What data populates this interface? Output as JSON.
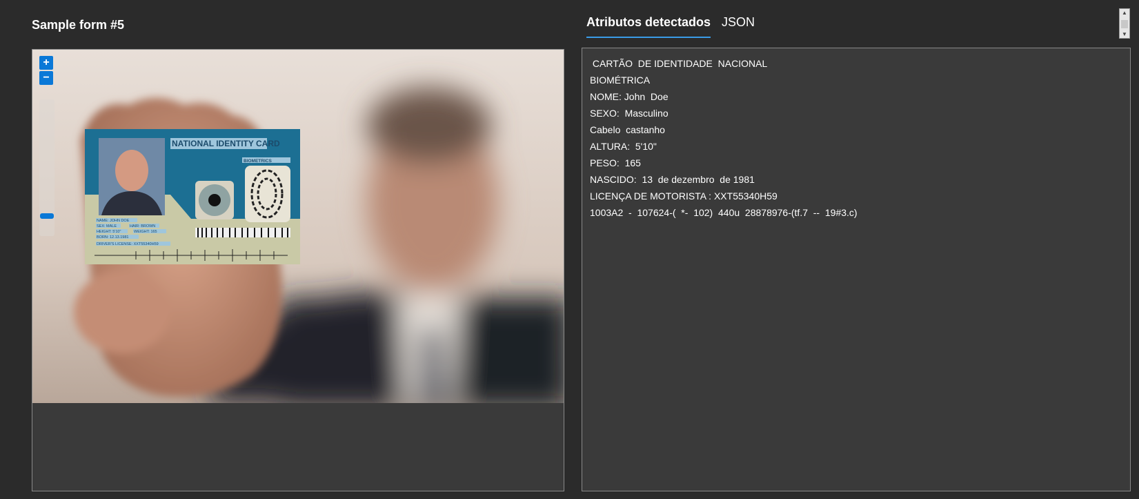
{
  "form": {
    "title": "Sample form #5"
  },
  "tabs": [
    {
      "label": "Atributos detectados",
      "active": true
    },
    {
      "label": "JSON",
      "active": false
    }
  ],
  "zoom": {
    "plus": "+",
    "minus": "−",
    "level": 0.13
  },
  "card": {
    "heading": "NATIONAL IDENTITY CARD",
    "biometrics": "BIOMETRICS",
    "name": "NAME: JOHN DOE",
    "sex": "SEX: MALE",
    "hair": "HAIR: BROWN",
    "height": "HEIGHT: 5'10\"",
    "weight": "WEIGHT: 165",
    "born": "BORN: 12.13.1981",
    "license": "DRIVER'S LICENSE: XXT55340H59"
  },
  "attributes": [
    " CARTÃO  DE IDENTIDADE  NACIONAL",
    "BIOMÉTRICA",
    "NOME: John  Doe",
    "SEXO:  Masculino",
    "Cabelo  castanho",
    "ALTURA:  5'10\"",
    "PESO:  165",
    "NASCIDO:  13  de dezembro  de 1981",
    "LICENÇA DE MOTORISTA : XXT55340H59",
    "1003A2  -  107624-(  *-  102)  440u  28878976-(tf.7  --  19#3.c)"
  ],
  "colors": {
    "accent": "#0a78d7",
    "tab_underline": "#3a9ce8",
    "background": "#2b2b2b",
    "panel": "#3a3a3a"
  }
}
